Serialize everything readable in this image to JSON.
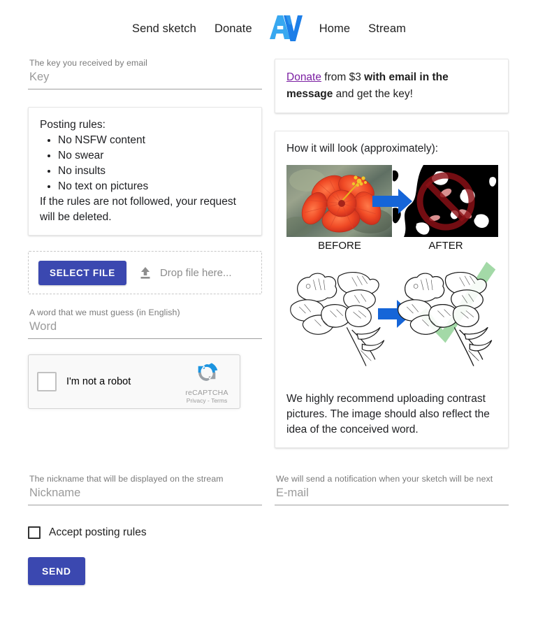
{
  "nav": {
    "logo_icon": "av-logo-icon",
    "links_left": [
      {
        "label": "Send sketch"
      },
      {
        "label": "Donate"
      }
    ],
    "links_right": [
      {
        "label": "Home"
      },
      {
        "label": "Stream"
      }
    ]
  },
  "key_field": {
    "label": "The key you received by email",
    "placeholder": "Key",
    "value": ""
  },
  "donate_card": {
    "link_label": "Donate",
    "text_1": " from $3 ",
    "bold_1": "with email in the message",
    "text_2": " and get the key!"
  },
  "rules_card": {
    "title": "Posting rules:",
    "items": [
      "No NSFW content",
      "No swear",
      "No insults",
      "No text on pictures"
    ],
    "footer": "If the rules are not followed, your request will be deleted."
  },
  "dropzone": {
    "button_label": "SELECT FILE",
    "upload_icon": "upload-icon",
    "hint": "Drop file here...",
    "button_color": "#3b48b0"
  },
  "word_field": {
    "label": "A word that we must guess (in English)",
    "placeholder": "Word",
    "value": ""
  },
  "recaptcha": {
    "checkbox_label": "I'm not a robot",
    "brand_icon": "recaptcha-icon",
    "brand_name": "reCAPTCHA",
    "legal": "Privacy - Terms"
  },
  "preview_card": {
    "title": "How it will look (approximately):",
    "example_bad": {
      "before_label": "BEFORE",
      "after_label": "AFTER",
      "verdict_icon": "prohibited-icon"
    },
    "example_good": {
      "verdict_icon": "check-icon"
    },
    "note": "We highly recommend uploading contrast pictures. The image should also reflect the idea of the conceived word."
  },
  "nickname_field": {
    "label": "The nickname that will be displayed on the stream",
    "placeholder": "Nickname",
    "value": ""
  },
  "email_field": {
    "label": "We will send a notification when your sketch will be next",
    "placeholder": "E-mail",
    "value": ""
  },
  "accept": {
    "label": "Accept posting rules",
    "checked": false
  },
  "submit": {
    "label": "SEND"
  }
}
